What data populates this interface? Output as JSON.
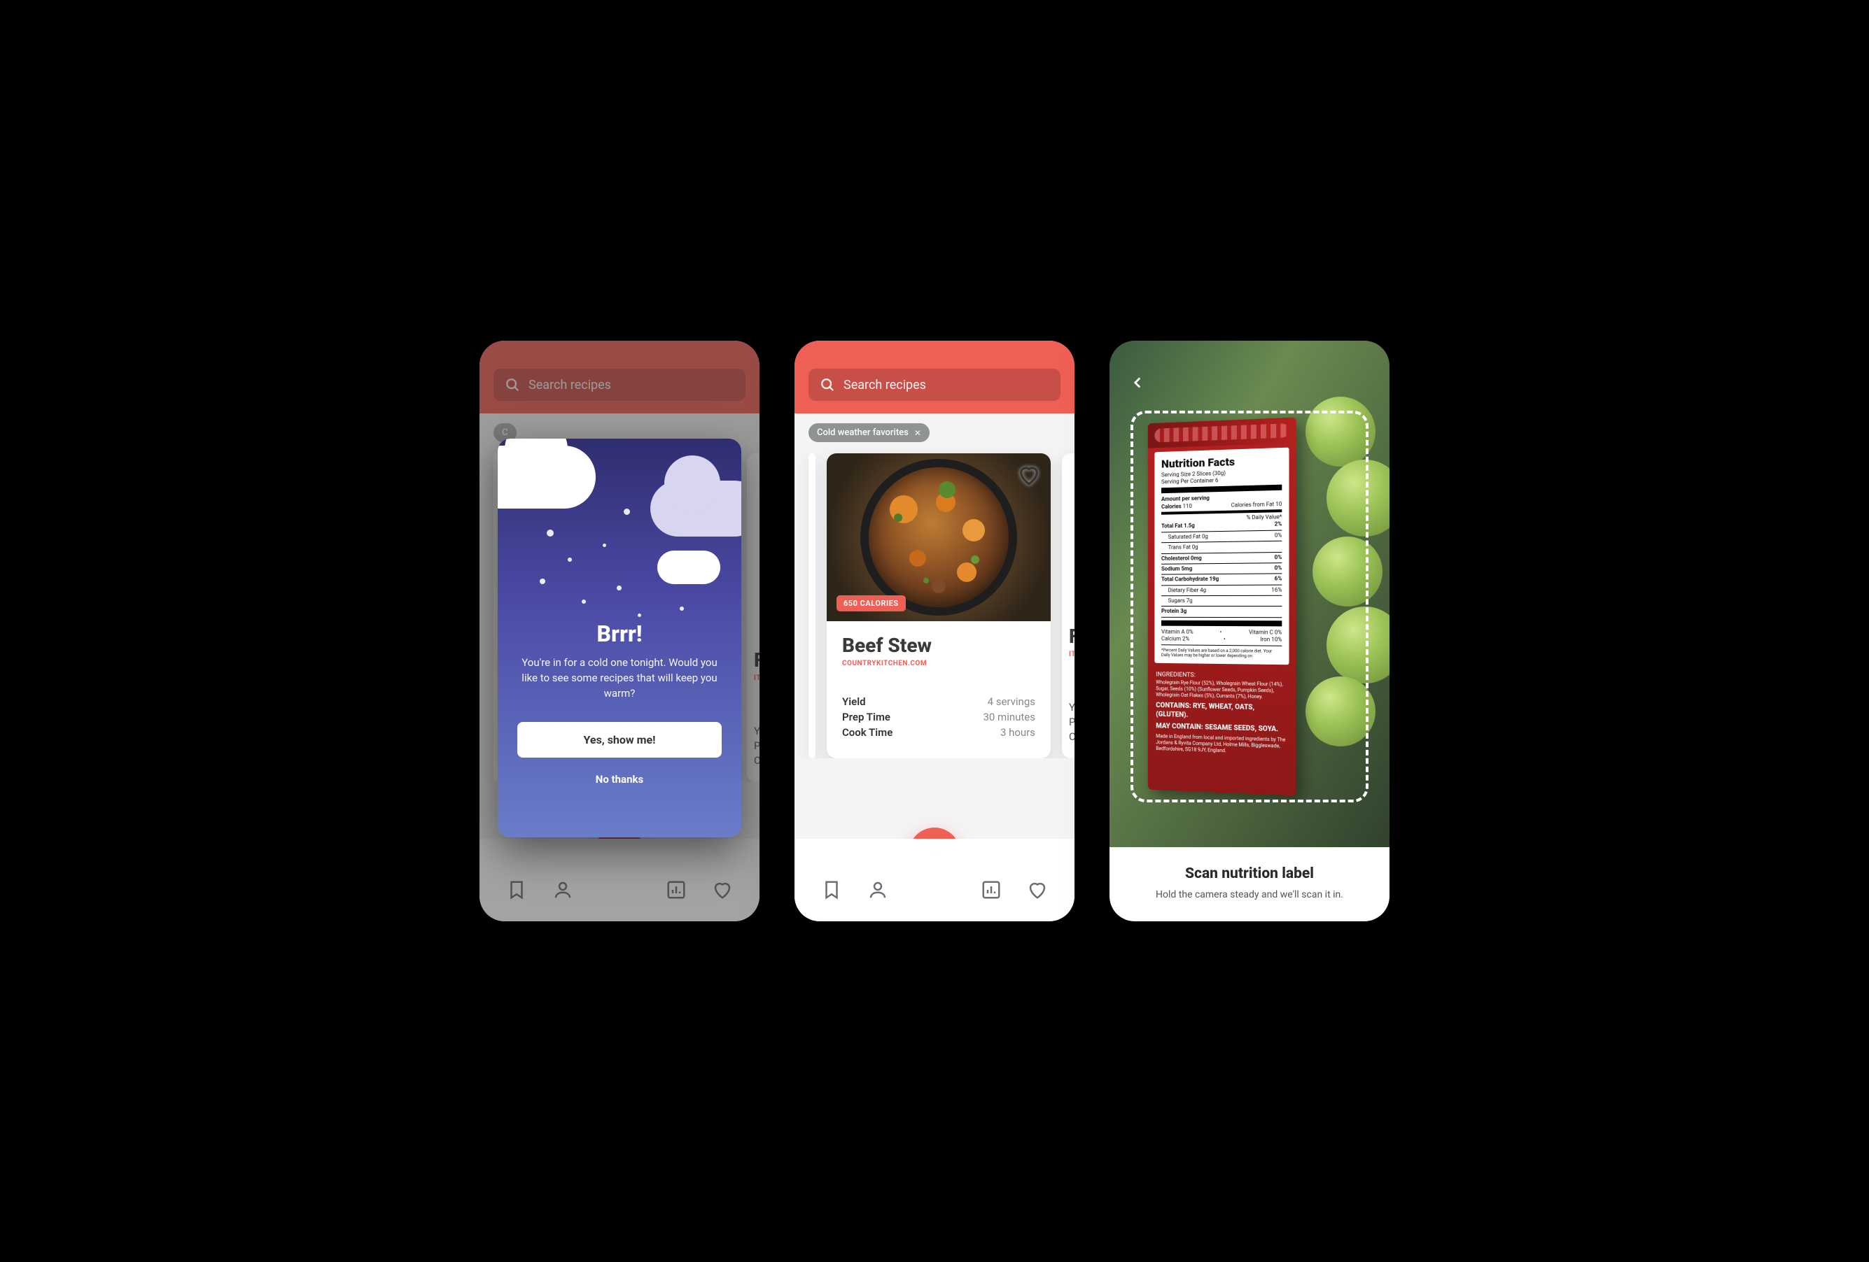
{
  "search": {
    "placeholder": "Search recipes"
  },
  "chip": {
    "label": "Cold weather favorites"
  },
  "recipe": {
    "calories_badge": "650 CALORIES",
    "title": "Beef Stew",
    "source": "COUNTRYKITCHEN.COM",
    "meta": {
      "yield_label": "Yield",
      "yield_value": "4 servings",
      "prep_label": "Prep Time",
      "prep_value": "30 minutes",
      "cook_label": "Cook Time",
      "cook_value": "3 hours"
    }
  },
  "peek": {
    "title_initial": "F",
    "source_initial": "IT",
    "meta1": "Y",
    "meta2": "P",
    "meta3": "C"
  },
  "modal": {
    "title": "Brrr!",
    "text": "You're in for a cold one tonight. Would you like to see some recipes that will keep you warm?",
    "yes": "Yes, show me!",
    "no": "No thanks"
  },
  "scan": {
    "title": "Scan nutrition label",
    "subtitle": "Hold the camera steady and we'll scan it in."
  },
  "nutrition": {
    "heading": "Nutrition Facts",
    "serving_size": "Serving Size 2 Slices (30g)",
    "servings_per": "Serving Per Container 6",
    "amount_per": "Amount per serving",
    "calories_lbl": "Calories",
    "calories_val": "110",
    "cal_from_fat": "Calories from Fat 10",
    "dv": "% Daily Value*",
    "rows": [
      {
        "l": "Total Fat 1.5g",
        "r": "2%",
        "b": true
      },
      {
        "l": "Saturated Fat 0g",
        "r": "0%",
        "ind": true
      },
      {
        "l": "Trans Fat 0g",
        "r": "",
        "ind": true
      },
      {
        "l": "Cholesterol 0mg",
        "r": "0%",
        "b": true
      },
      {
        "l": "Sodium 5mg",
        "r": "0%",
        "b": true
      },
      {
        "l": "Total Carbohydrate 19g",
        "r": "6%",
        "b": true
      },
      {
        "l": "Dietary Fiber 4g",
        "r": "16%",
        "ind": true
      },
      {
        "l": "Sugars 7g",
        "r": "",
        "ind": true
      },
      {
        "l": "Protein 3g",
        "r": "",
        "b": true
      }
    ],
    "vits": [
      {
        "l": "Vitamin A 0%",
        "r": "Vitamin C 0%"
      },
      {
        "l": "Calcium 2%",
        "r": "Iron 10%"
      }
    ],
    "disclaimer": "*Percent Daily Values are based on a 2,000 calorie diet. Your Daily Values may be higher or lower depending on",
    "contains": "CONTAINS: RYE, WHEAT, OATS, (GLUTEN).",
    "may": "MAY CONTAIN: SESAME SEEDS, SOYA.",
    "made": "Made in England from local and imported ingredients by The Jordans & Ryvita Company Ltd, Holme Mills, Biggleswade, Bedfordshire, SG18 9JY, England."
  }
}
